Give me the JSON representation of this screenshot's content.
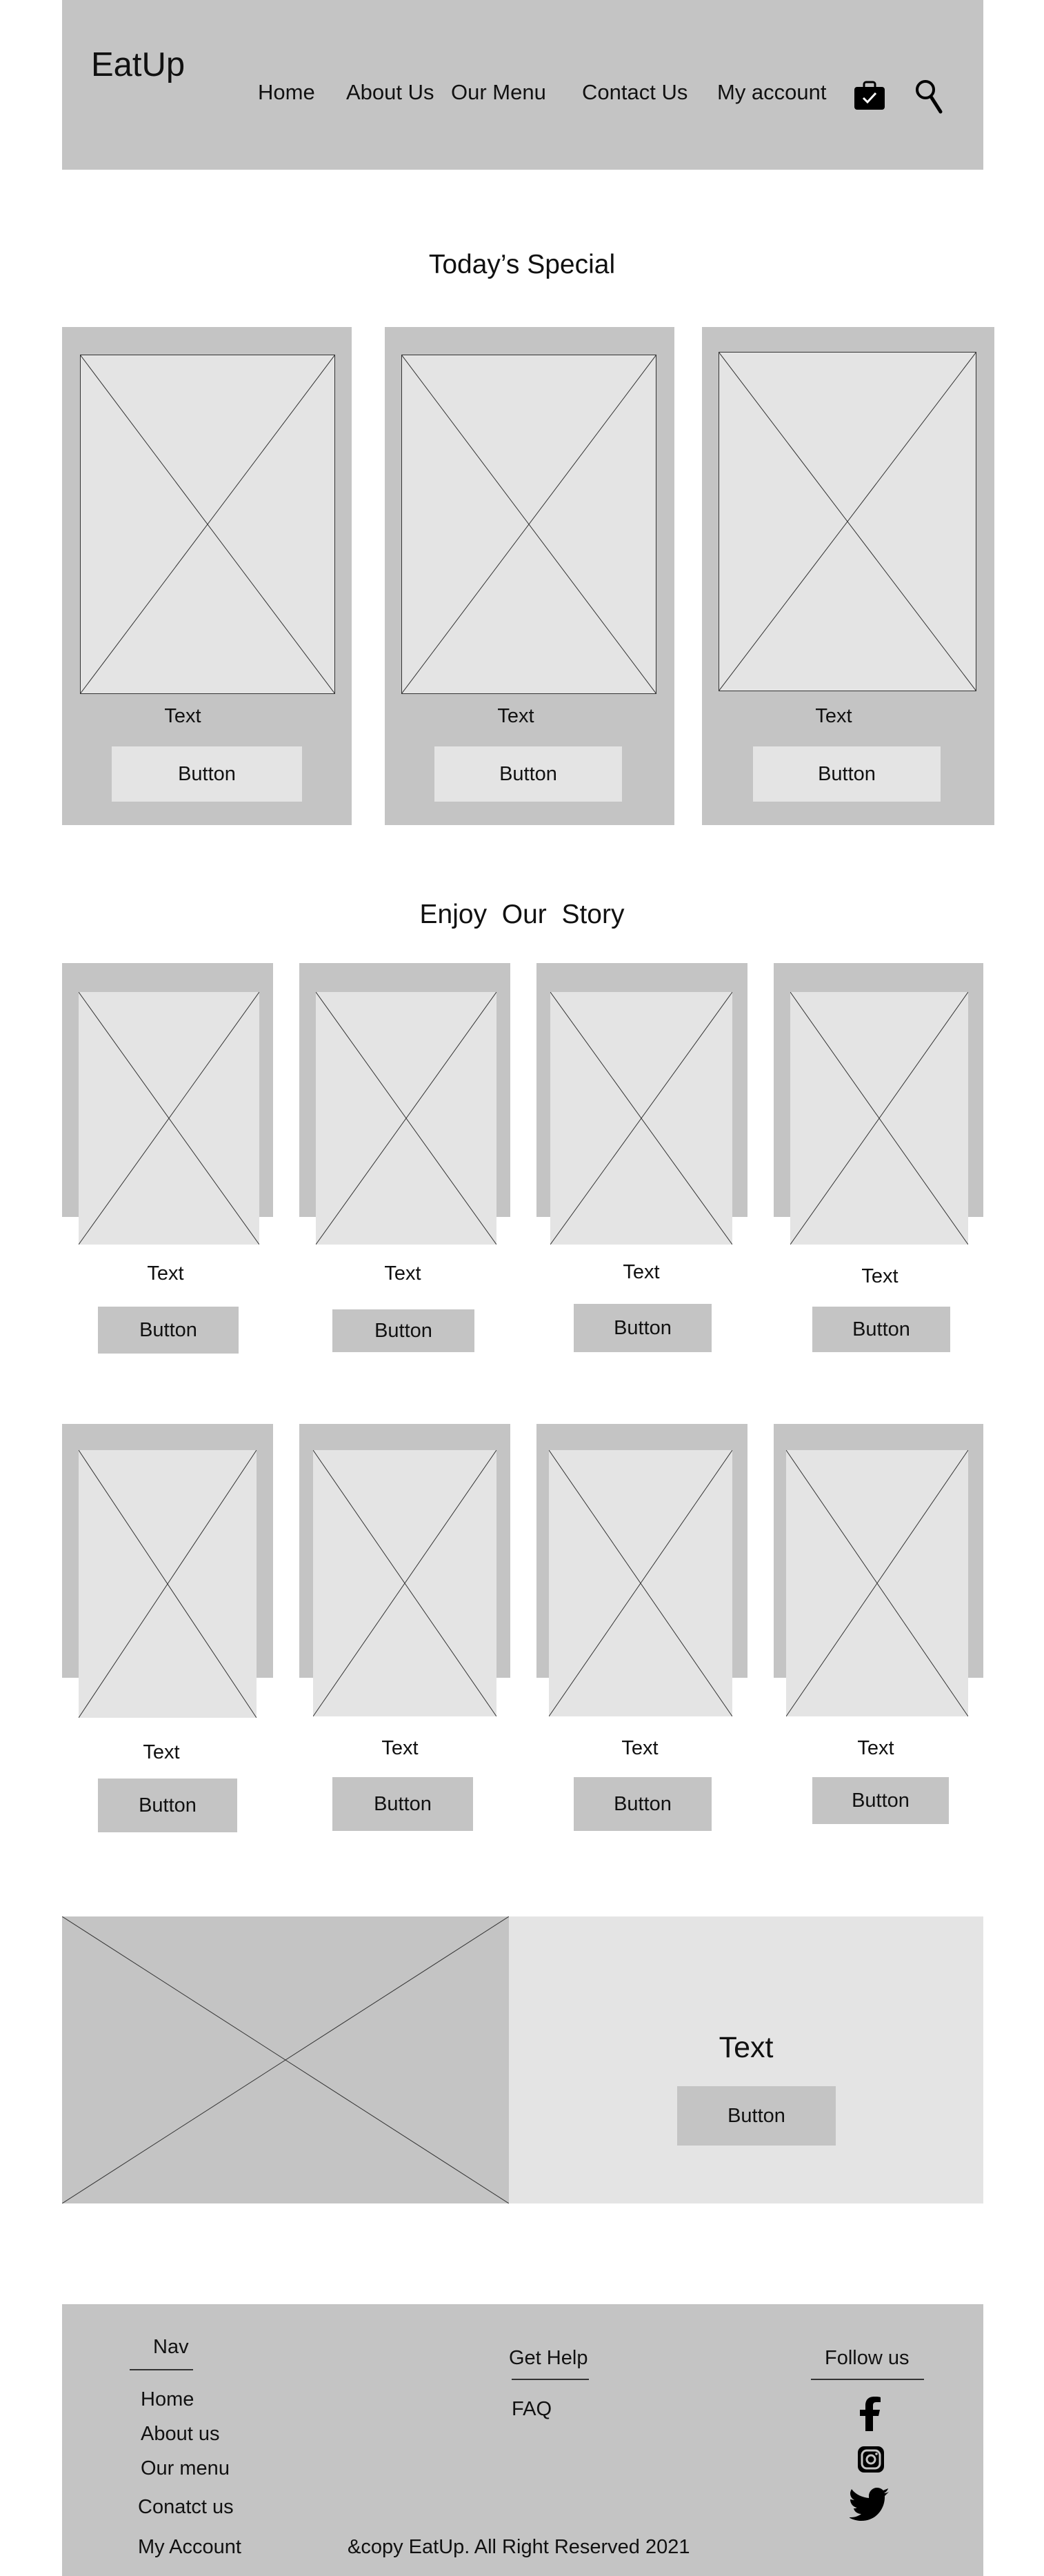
{
  "header": {
    "logo": "EatUp",
    "nav": [
      "Home",
      "About Us",
      "Our Menu",
      "Contact Us",
      "My account"
    ],
    "icons": [
      "shopping-bag-icon",
      "search-icon"
    ]
  },
  "specials": {
    "title": "Today’s Special",
    "cards": [
      {
        "text": "Text",
        "button": "Button"
      },
      {
        "text": "Text",
        "button": "Button"
      },
      {
        "text": "Text",
        "button": "Button"
      }
    ]
  },
  "story": {
    "title": "Enjoy  Our  Story",
    "row1": [
      {
        "text": "Text",
        "button": "Button"
      },
      {
        "text": "Text",
        "button": "Button"
      },
      {
        "text": "Text",
        "button": "Button"
      },
      {
        "text": "Text",
        "button": "Button"
      }
    ],
    "row2": [
      {
        "text": "Text",
        "button": "Button"
      },
      {
        "text": "Text",
        "button": "Button"
      },
      {
        "text": "Text",
        "button": "Button"
      },
      {
        "text": "Text",
        "button": "Button"
      }
    ]
  },
  "feature": {
    "text": "Text",
    "button": "Button"
  },
  "footer": {
    "nav_heading": "Nav",
    "nav_links": [
      "Home",
      "About us",
      "Our menu",
      "Conatct us",
      "My Account"
    ],
    "help_heading": "Get Help",
    "help_links": [
      "FAQ"
    ],
    "follow_heading": "Follow us",
    "social_icons": [
      "facebook-icon",
      "instagram-icon",
      "twitter-icon"
    ],
    "copyright": "&copy EatUp. All Right Reserved 2021"
  },
  "colors": {
    "panel": "#c4c4c4",
    "placeholder": "#e4e4e4",
    "text": "#111111"
  }
}
